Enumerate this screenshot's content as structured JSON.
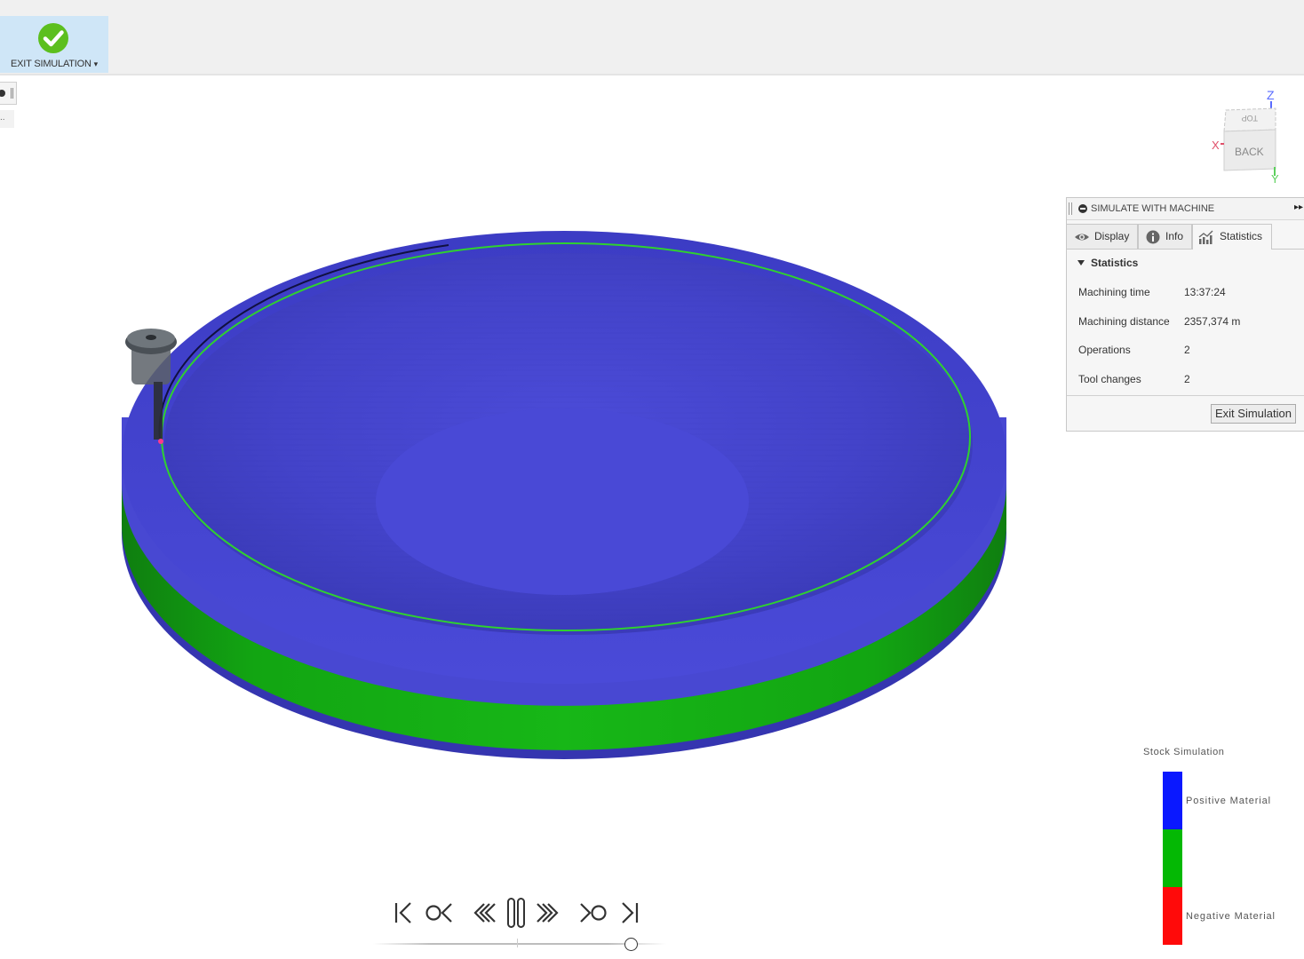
{
  "toolbar": {
    "exit_simulation_label": "EXIT SIMULATION",
    "exit_simulation_dropdown": "▾"
  },
  "viewcube": {
    "top_label": "TOP",
    "back_label": "BACK",
    "axis_x": "X",
    "axis_y": "Y",
    "axis_z": "Z"
  },
  "panel": {
    "title": "SIMULATE WITH MACHINE",
    "expand_icon": "▸▸",
    "tabs": [
      {
        "label": "Display",
        "icon": "eye-icon"
      },
      {
        "label": "Info",
        "icon": "info-icon"
      },
      {
        "label": "Statistics",
        "icon": "chart-icon",
        "active": true
      }
    ],
    "section_title": "Statistics",
    "stats": [
      {
        "key": "Machining time",
        "value": "13:37:24"
      },
      {
        "key": "Machining distance",
        "value": "2357,374 m"
      },
      {
        "key": "Operations",
        "value": "2"
      },
      {
        "key": "Tool changes",
        "value": "2"
      }
    ],
    "exit_button": "Exit Simulation"
  },
  "legend": {
    "title": "Stock Simulation",
    "positive": "Positive Material",
    "negative": "Negative Material",
    "colors": {
      "positive": "#0a18ff",
      "neutral": "#04b804",
      "negative": "#ff0a0a"
    }
  },
  "playback": {
    "buttons": [
      "skip-to-start-icon",
      "previous-operation-icon",
      "rewind-icon",
      "pause-icon",
      "fast-forward-icon",
      "next-operation-icon",
      "skip-to-end-icon"
    ],
    "progress": 0.9
  },
  "colors": {
    "stock_blue": "#4a4ad6",
    "stock_green": "#14a814",
    "exit_button_bg": "#cfe6f7",
    "check_green": "#5cbf1e"
  }
}
